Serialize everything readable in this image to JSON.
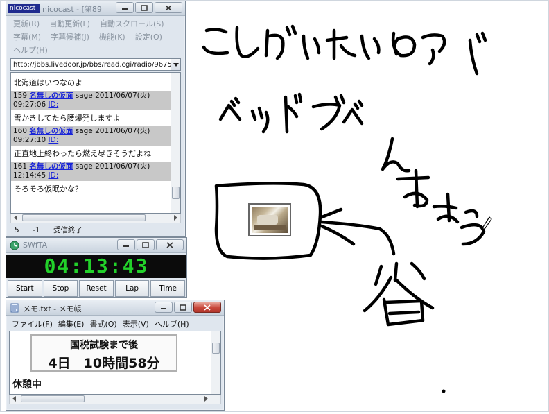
{
  "browser": {
    "title": "nicocast - [第89",
    "title_badge": "nicocast",
    "menu": [
      "更新(R)",
      "自動更新(L)",
      "自動スクロール(S)",
      "字幕(M)",
      "字幕候補(J)",
      "機能(K)",
      "設定(O)",
      "ヘルプ(H)"
    ],
    "url": "http://jbbs.livedoor.jp/bbs/read.cgi/radio/9675",
    "first_line": "北海道はいつなのよ",
    "posts": [
      {
        "num": "159",
        "name": "名無しの仮面",
        "meta": "sage 2011/06/07(火)",
        "time": "09:27:06",
        "id": "ID:",
        "body": "雪かきしてたら腰爆発しますよ"
      },
      {
        "num": "160",
        "name": "名無しの仮面",
        "meta": "sage 2011/06/07(火)",
        "time": "09:27:10",
        "id": "ID:",
        "body": "正直地上終わったら燃え尽きそうだよね"
      },
      {
        "num": "161",
        "name": "名無しの仮面",
        "meta": "sage 2011/06/07(火)",
        "time": "12:14:45",
        "id": "ID:",
        "body": "そろそろ仮眠かな？"
      }
    ],
    "status": [
      "5",
      "-1",
      "受信終了"
    ]
  },
  "timer": {
    "title": "SWfTA",
    "display": "04:13:43",
    "buttons": [
      "Start",
      "Stop",
      "Reset",
      "Lap",
      "Time"
    ],
    "colors": {
      "digits": "#22d12a",
      "background": "#0b0b0b"
    }
  },
  "notepad": {
    "title": "メモ.txt - メモ帳",
    "menu": [
      "ファイル(F)",
      "編集(E)",
      "書式(O)",
      "表示(V)",
      "ヘルプ(H)"
    ],
    "line1": "国税試験まで後",
    "line2": "4日　10時間58分",
    "status_text": "休憩中"
  },
  "drawing": {
    "note": "",
    "icons": [
      "pen-cursor-icon",
      "photo-thumbnail"
    ]
  }
}
